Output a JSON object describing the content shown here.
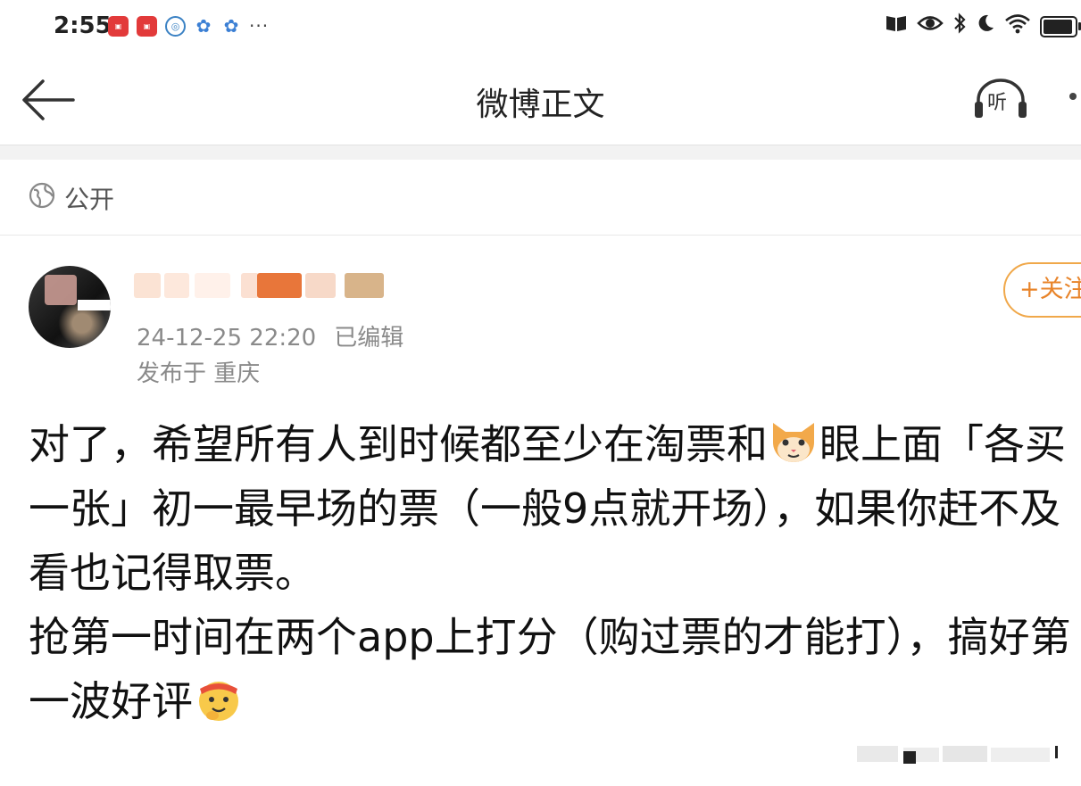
{
  "status_bar": {
    "time": "2:55",
    "more": "···"
  },
  "nav": {
    "title": "微博正文",
    "listen_label": "听"
  },
  "visibility": {
    "label": "公开"
  },
  "post": {
    "timestamp": "24-12-25 22:20",
    "edited": "已编辑",
    "location": "发布于 重庆",
    "follow_label": "+关注",
    "paragraph1_a": "对了，希望所有人到时候都至少在淘票和",
    "paragraph1_b": "眼上面「各买一张」初一最早场的票（一般9点就开场），如果你赶不及看也记得取票。",
    "paragraph2": "抢第一时间在两个app上打分（购过票的才能打），搞好第一波好评"
  },
  "colors": {
    "accent": "#e8842a",
    "follow_border": "#f0a84a",
    "meta_text": "#8a8a8a"
  }
}
